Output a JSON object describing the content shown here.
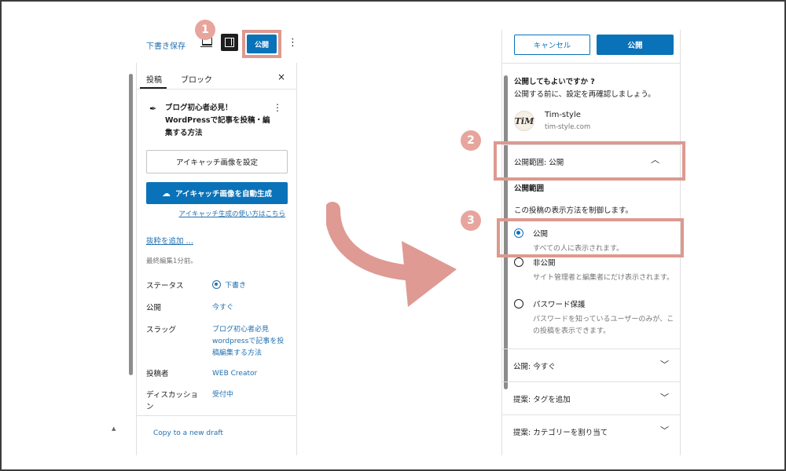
{
  "left": {
    "toolbar": {
      "draft_save": "下書き保存",
      "publish": "公開",
      "more": "⋮"
    },
    "tabs": [
      {
        "label": "投稿"
      },
      {
        "label": "ブロック"
      }
    ],
    "close": "×",
    "post_title": "ブログ初心者必見！WordPressで記事を投稿・編集する方法",
    "post_more": "⋮",
    "featured_image_button": "アイキャッチ画像を設定",
    "auto_generate_button": "アイキャッチ画像を自動生成",
    "howto_link": "アイキャッチ生成の使い方はこちら",
    "excerpt_link": "抜粋を追加 …",
    "last_edited": "最終編集1分前。",
    "meta": [
      {
        "label": "ステータス",
        "value": "下書き"
      },
      {
        "label": "公開",
        "value": "今すぐ"
      },
      {
        "label": "スラッグ",
        "value": "ブログ初心者必見wordpressで記事を投稿編集する方法"
      },
      {
        "label": "投稿者",
        "value": "WEB Creator"
      },
      {
        "label": "ディスカッション",
        "value": "受付中"
      }
    ],
    "copy_draft": "Copy to a new draft",
    "scroll_up": "▲"
  },
  "right": {
    "cancel": "キャンセル",
    "publish": "公開",
    "confirm_title": "公開してもよいですか ?",
    "confirm_sub": "公開する前に、設定を再確認しましょう。",
    "site": {
      "logo": "TiM",
      "name": "Tim-style",
      "url": "tim-style.com"
    },
    "visibility_header": "公開範囲: 公開",
    "visibility_label": "公開範囲",
    "visibility_desc": "この投稿の表示方法を制御します。",
    "options": [
      {
        "label": "公開",
        "help": "すべての人に表示されます。",
        "checked": true
      },
      {
        "label": "非公開",
        "help": "サイト管理者と編集者にだけ表示されます。",
        "checked": false
      },
      {
        "label": "パスワード保護",
        "help": "パスワードを知っているユーザーのみが、この投稿を表示できます。",
        "checked": false
      }
    ],
    "rows": [
      {
        "label": "公開: 今すぐ"
      },
      {
        "label": "提案: タグを追加"
      },
      {
        "label": "提案: カテゴリーを割り当て"
      }
    ],
    "chevron_up": "︿",
    "chevron_down": "﹀"
  },
  "badges": [
    "1",
    "2",
    "3"
  ],
  "colors": {
    "accent": "#0a72b8",
    "highlight": "#dd9990",
    "badge": "#e7a59d",
    "arrow": "#de9a93"
  }
}
